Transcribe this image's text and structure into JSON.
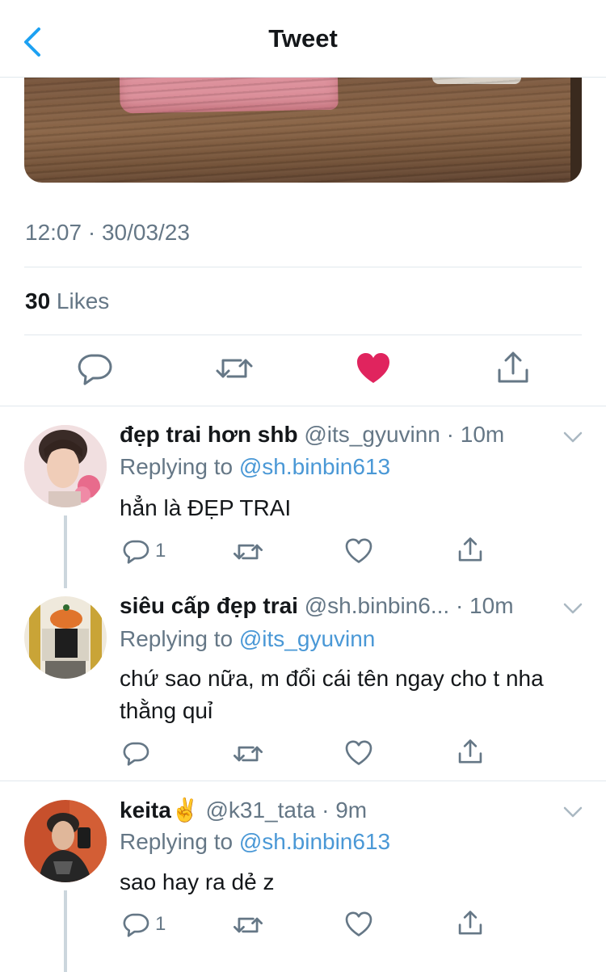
{
  "header": {
    "title": "Tweet",
    "back_icon": "chevron-left-icon",
    "accent": "#1da1f2"
  },
  "tweet": {
    "timestamp": "12:07 · 30/03/23",
    "likes_count": "30",
    "likes_label": " Likes",
    "liked": true,
    "like_color": "#e0245e"
  },
  "replies": [
    {
      "name": "đẹp trai hơn shb",
      "meta": " @its_gyuvinn · 10m",
      "replying_label": "Replying to ",
      "mention": "@sh.binbin613",
      "text": "hẳn là ĐẸP TRAI",
      "reply_count": "1"
    },
    {
      "name": "siêu cấp đẹp trai",
      "meta": "  @sh.binbin6... · 10m",
      "replying_label": "Replying to ",
      "mention": "@its_gyuvinn",
      "text": "chứ sao nữa, m đổi cái tên ngay cho t nha thằng quỉ",
      "reply_count": ""
    },
    {
      "name": "keita",
      "name_emoji": "✌️",
      "meta": " @k31_tata · 9m",
      "replying_label": "Replying to ",
      "mention": "@sh.binbin613",
      "text": "sao hay ra dẻ z",
      "reply_count": "1"
    }
  ]
}
